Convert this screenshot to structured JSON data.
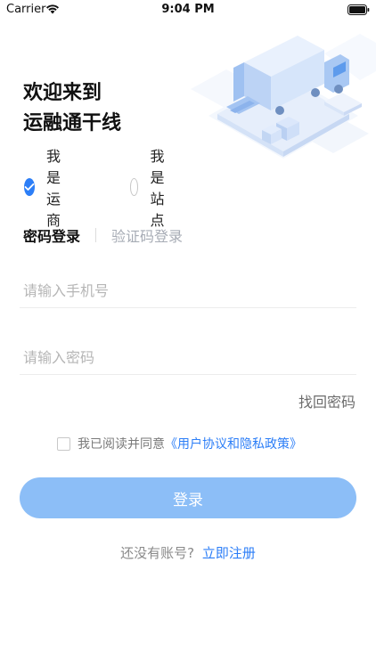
{
  "status_bar": {
    "carrier": "Carrier",
    "time": "9:04 PM"
  },
  "welcome": {
    "line1": "欢迎来到",
    "line2": "运融通干线"
  },
  "roles": [
    {
      "label": "我是运商",
      "checked": true
    },
    {
      "label": "我是站点",
      "checked": false
    }
  ],
  "tabs": [
    {
      "label": "密码登录",
      "active": true
    },
    {
      "label": "验证码登录",
      "active": false
    }
  ],
  "phone": {
    "placeholder": "请输入手机号",
    "value": ""
  },
  "password": {
    "placeholder": "请输入密码",
    "value": ""
  },
  "forgot_password": "找回密码",
  "agreement": {
    "checked": false,
    "text": "我已阅读并同意",
    "link": "《用户协议和隐私政策》"
  },
  "login_button": "登录",
  "register": {
    "prompt": "还没有账号?",
    "link": "立即注册"
  },
  "colors": {
    "accent": "#2c7ef7",
    "button_disabled": "#8cbef7",
    "placeholder": "#b6b6b6",
    "inactive_tab": "#a7acb5"
  },
  "icons": [
    "wifi-icon",
    "battery-icon",
    "check-icon",
    "truck-illustration"
  ]
}
